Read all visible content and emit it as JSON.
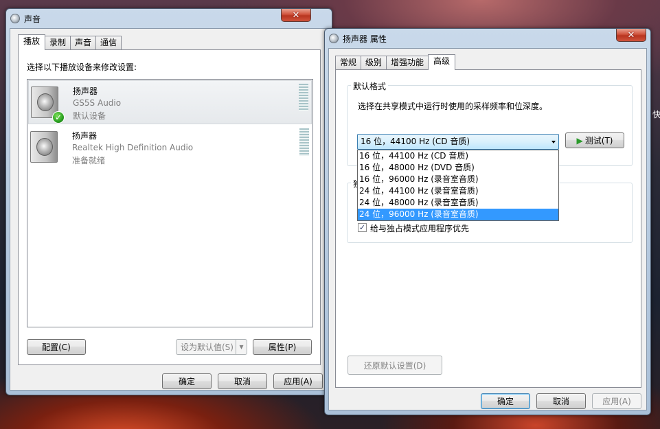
{
  "side_text": "快",
  "sound_window": {
    "title": "声音",
    "close_label": "✕",
    "tabs": [
      "播放",
      "录制",
      "声音",
      "通信"
    ],
    "instruction": "选择以下播放设备来修改设置:",
    "devices": [
      {
        "name": "扬声器",
        "sub": "GS5S Audio",
        "status": "默认设备"
      },
      {
        "name": "扬声器",
        "sub": "Realtek High Definition Audio",
        "status": "准备就绪"
      }
    ],
    "configure_label": "配置(C)",
    "set_default_label": "设为默认值(S)",
    "set_default_arrow": "▾",
    "properties_label": "属性(P)",
    "ok_label": "确定",
    "cancel_label": "取消",
    "apply_label": "应用(A)"
  },
  "props_window": {
    "title": "扬声器 属性",
    "close_label": "✕",
    "tabs": [
      "常规",
      "级别",
      "增强功能",
      "高级"
    ],
    "default_format_group": "默认格式",
    "description": "选择在共享模式中运行时使用的采样频率和位深度。",
    "selected_format": "16 位，44100 Hz (CD 音质)",
    "test_label": "测试(T)",
    "test_icon": "▶",
    "options": [
      "16 位，44100 Hz (CD 音质)",
      "16 位，48000 Hz (DVD 音质)",
      "16 位，96000 Hz (录音室音质)",
      "24 位，44100 Hz (录音室音质)",
      "24 位，48000 Hz (录音室音质)",
      "24 位，96000 Hz (录音室音质)"
    ],
    "highlighted_index": 5,
    "exclusive_group_partial": "独",
    "exclusive_priority_label": "给与独占模式应用程序优先",
    "exclusive_priority_checked": "✓",
    "restore_defaults_label": "还原默认设置(D)",
    "ok_label": "确定",
    "cancel_label": "取消",
    "apply_label": "应用(A)"
  }
}
